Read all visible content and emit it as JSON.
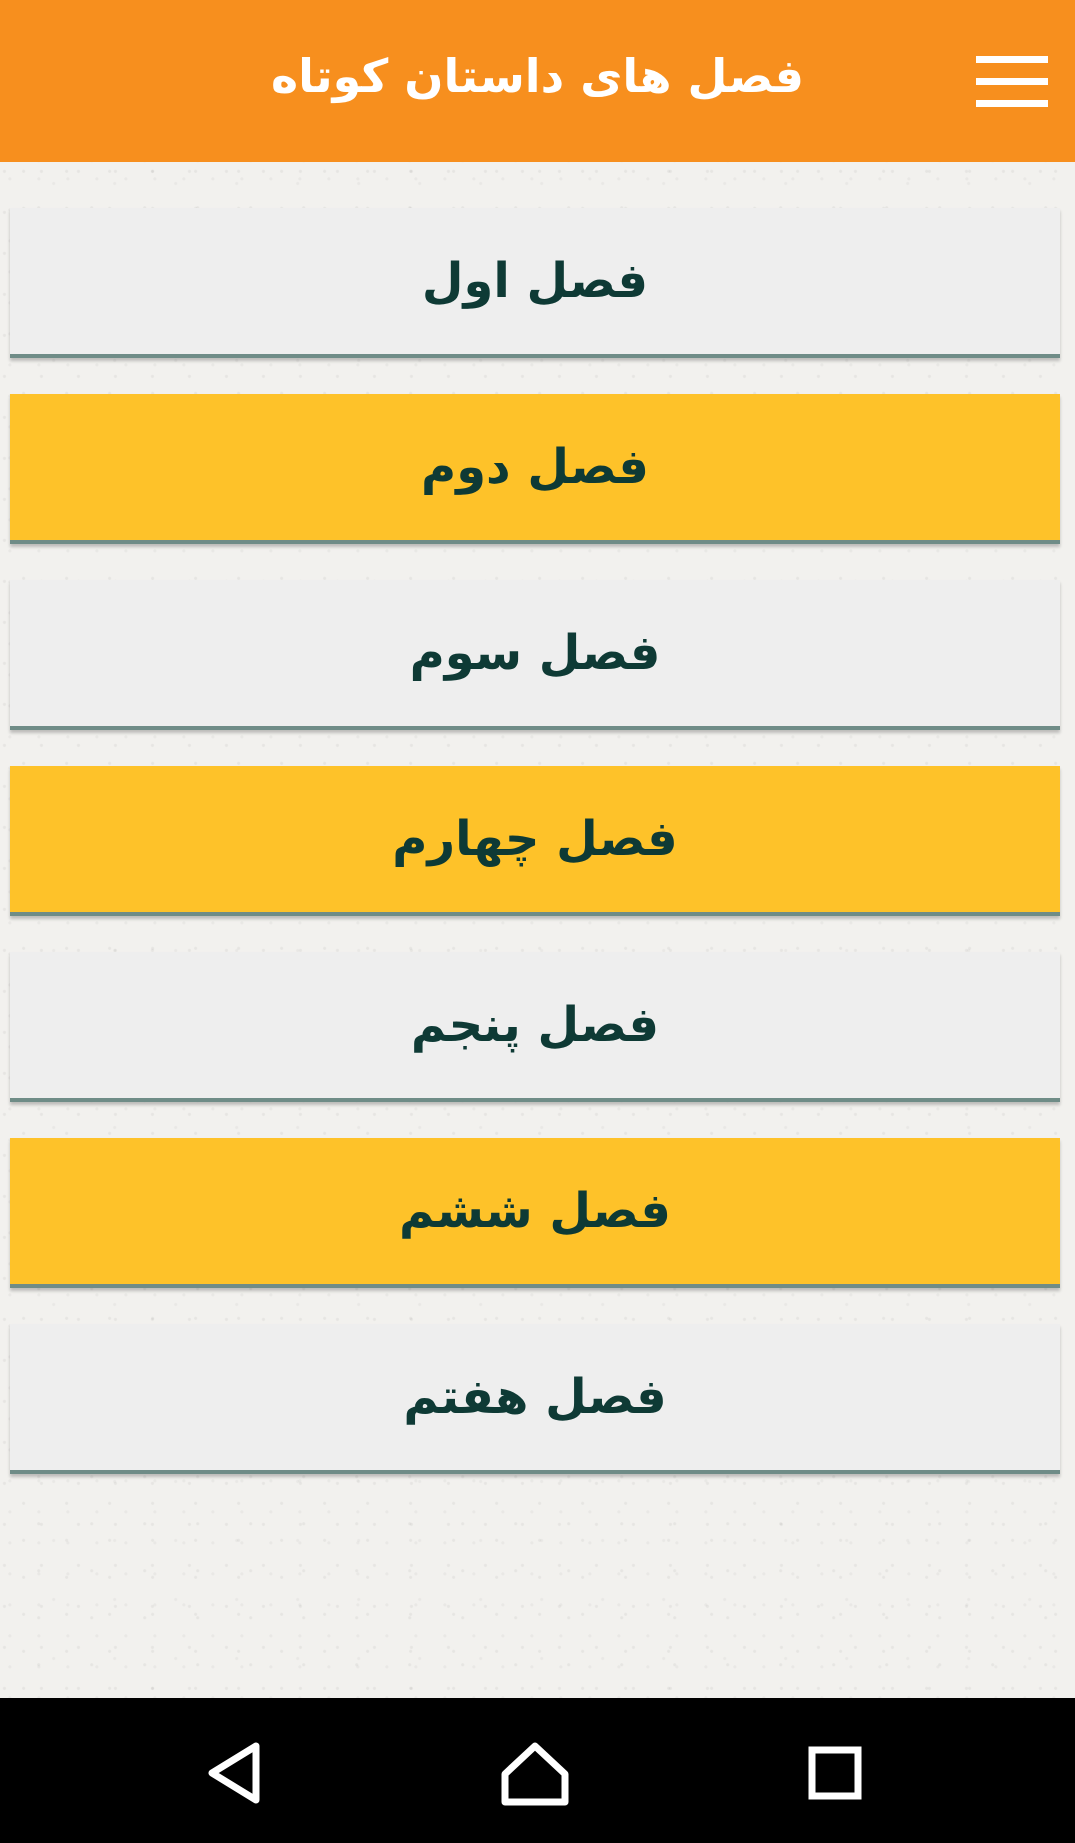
{
  "app_bar": {
    "title": "فصل های داستان کوتاه",
    "background": "#f78f1e",
    "menu_icon": "hamburger-menu-icon"
  },
  "chapters": [
    {
      "label": "فصل اول",
      "color": "#eeeeee"
    },
    {
      "label": "فصل دوم",
      "color": "#fec229"
    },
    {
      "label": "فصل سوم",
      "color": "#eeeeee"
    },
    {
      "label": "فصل چهارم",
      "color": "#fec229"
    },
    {
      "label": "فصل پنجم",
      "color": "#eeeeee"
    },
    {
      "label": "فصل ششم",
      "color": "#fec229"
    },
    {
      "label": "فصل هفتم",
      "color": "#eeeeee"
    }
  ],
  "nav_bar": {
    "back_icon": "back-triangle-icon",
    "home_icon": "home-icon",
    "recents_icon": "recents-square-icon"
  }
}
